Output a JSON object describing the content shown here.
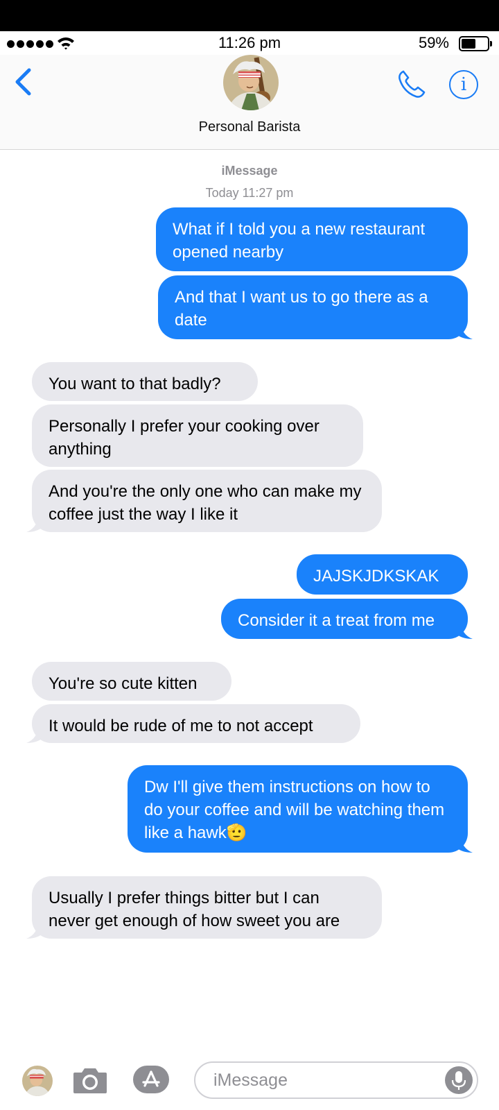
{
  "status_bar": {
    "time": "11:26 pm",
    "battery_percent": "59%",
    "battery_level": 0.59,
    "signal_dots": 5
  },
  "header": {
    "contact_name": "Personal Barista"
  },
  "conversation": {
    "service": "iMessage",
    "timestamp": "Today 11:27 pm"
  },
  "messages": [
    {
      "direction": "out",
      "text": "What if I told you a new restaurant opened nearby"
    },
    {
      "direction": "out",
      "text": "And that I want us to go there as a date"
    },
    {
      "direction": "in",
      "text": "You want to that badly?"
    },
    {
      "direction": "in",
      "text": "Personally I prefer your cooking over anything"
    },
    {
      "direction": "in",
      "text": "And you're the only one who can make my coffee just the way I like it"
    },
    {
      "direction": "out",
      "text": "JAJSKJDKSKAK"
    },
    {
      "direction": "out",
      "text": "Consider it a treat from me"
    },
    {
      "direction": "in",
      "text": "You're so cute kitten"
    },
    {
      "direction": "in",
      "text": "It would be rude of me to not accept"
    },
    {
      "direction": "out",
      "text": "Dw I'll give them instructions on how to do your coffee and will be watching them like a hawk🫡"
    },
    {
      "direction": "in",
      "text": "Usually I prefer things bitter but I can never get enough of how sweet you are"
    }
  ],
  "composer": {
    "placeholder": "iMessage"
  },
  "colors": {
    "outgoing_bubble": "#1a82fb",
    "incoming_bubble": "#e8e8ed",
    "accent": "#1a7cf5",
    "meta_text": "#8e8e93"
  },
  "icons": [
    "back-chevron-icon",
    "phone-icon",
    "info-icon",
    "camera-icon",
    "app-store-icon",
    "microphone-icon",
    "wifi-icon",
    "battery-icon"
  ]
}
